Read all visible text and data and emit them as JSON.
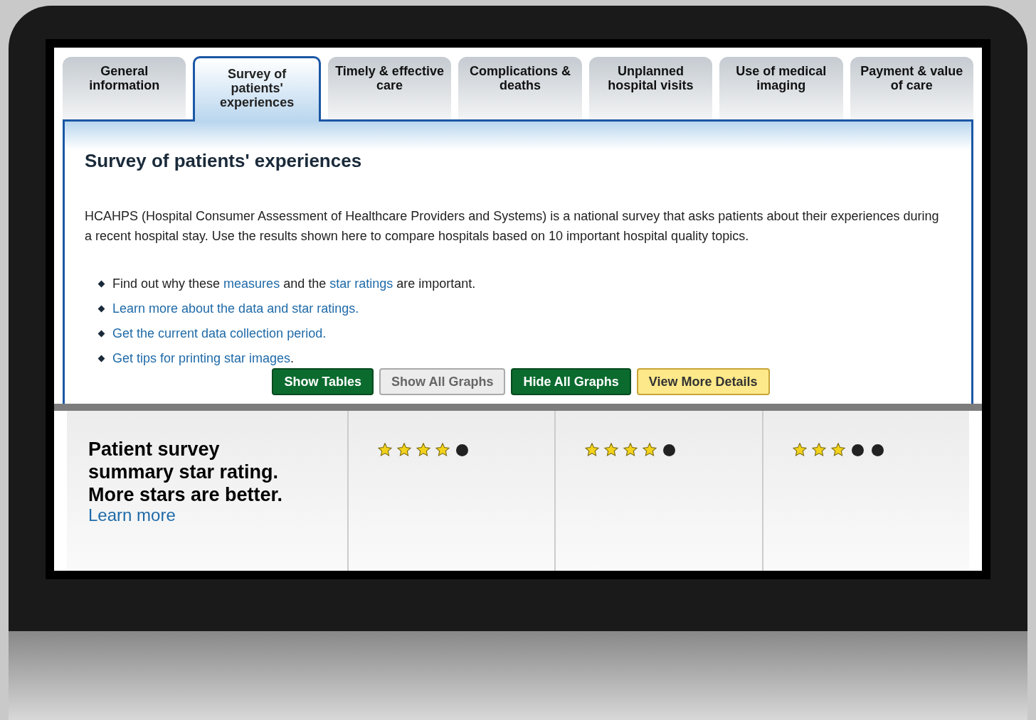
{
  "tabs": [
    {
      "label": "General information",
      "selected": false
    },
    {
      "label": "Survey of patients' experiences",
      "selected": true
    },
    {
      "label": "Timely & effective care",
      "selected": false
    },
    {
      "label": "Complications & deaths",
      "selected": false
    },
    {
      "label": "Unplanned hospital visits",
      "selected": false
    },
    {
      "label": "Use of medical imaging",
      "selected": false
    },
    {
      "label": "Payment & value of care",
      "selected": false
    }
  ],
  "panel": {
    "heading": "Survey of patients' experiences",
    "intro": "HCAHPS (Hospital Consumer Assessment of Healthcare Providers and Systems) is a national survey that asks patients about their experiences during a recent hospital stay. Use the results shown here to compare hospitals based on 10 important hospital quality topics.",
    "bullets": [
      [
        {
          "text": "Find out why these ",
          "link": false
        },
        {
          "text": "measures",
          "link": true
        },
        {
          "text": " and the ",
          "link": false
        },
        {
          "text": "star ratings",
          "link": true
        },
        {
          "text": " are important.",
          "link": false
        }
      ],
      [
        {
          "text": "Learn more about the data and star ratings.",
          "link": true
        }
      ],
      [
        {
          "text": "Get the current data collection period.",
          "link": true
        }
      ],
      [
        {
          "text": "Get tips for printing star images",
          "link": true
        },
        {
          "text": ".",
          "link": false
        }
      ]
    ],
    "buttons": [
      {
        "label": "Show Tables",
        "kind": "green"
      },
      {
        "label": "Show All Graphs",
        "kind": "grey"
      },
      {
        "label": "Hide All Graphs",
        "kind": "green"
      },
      {
        "label": "View More Details",
        "kind": "yellow"
      }
    ]
  },
  "rating_row": {
    "label": "Patient survey summary star rating. More stars are better.",
    "link": "Learn more",
    "hospitals": [
      {
        "stars": 4
      },
      {
        "stars": 4
      },
      {
        "stars": 3
      }
    ]
  }
}
